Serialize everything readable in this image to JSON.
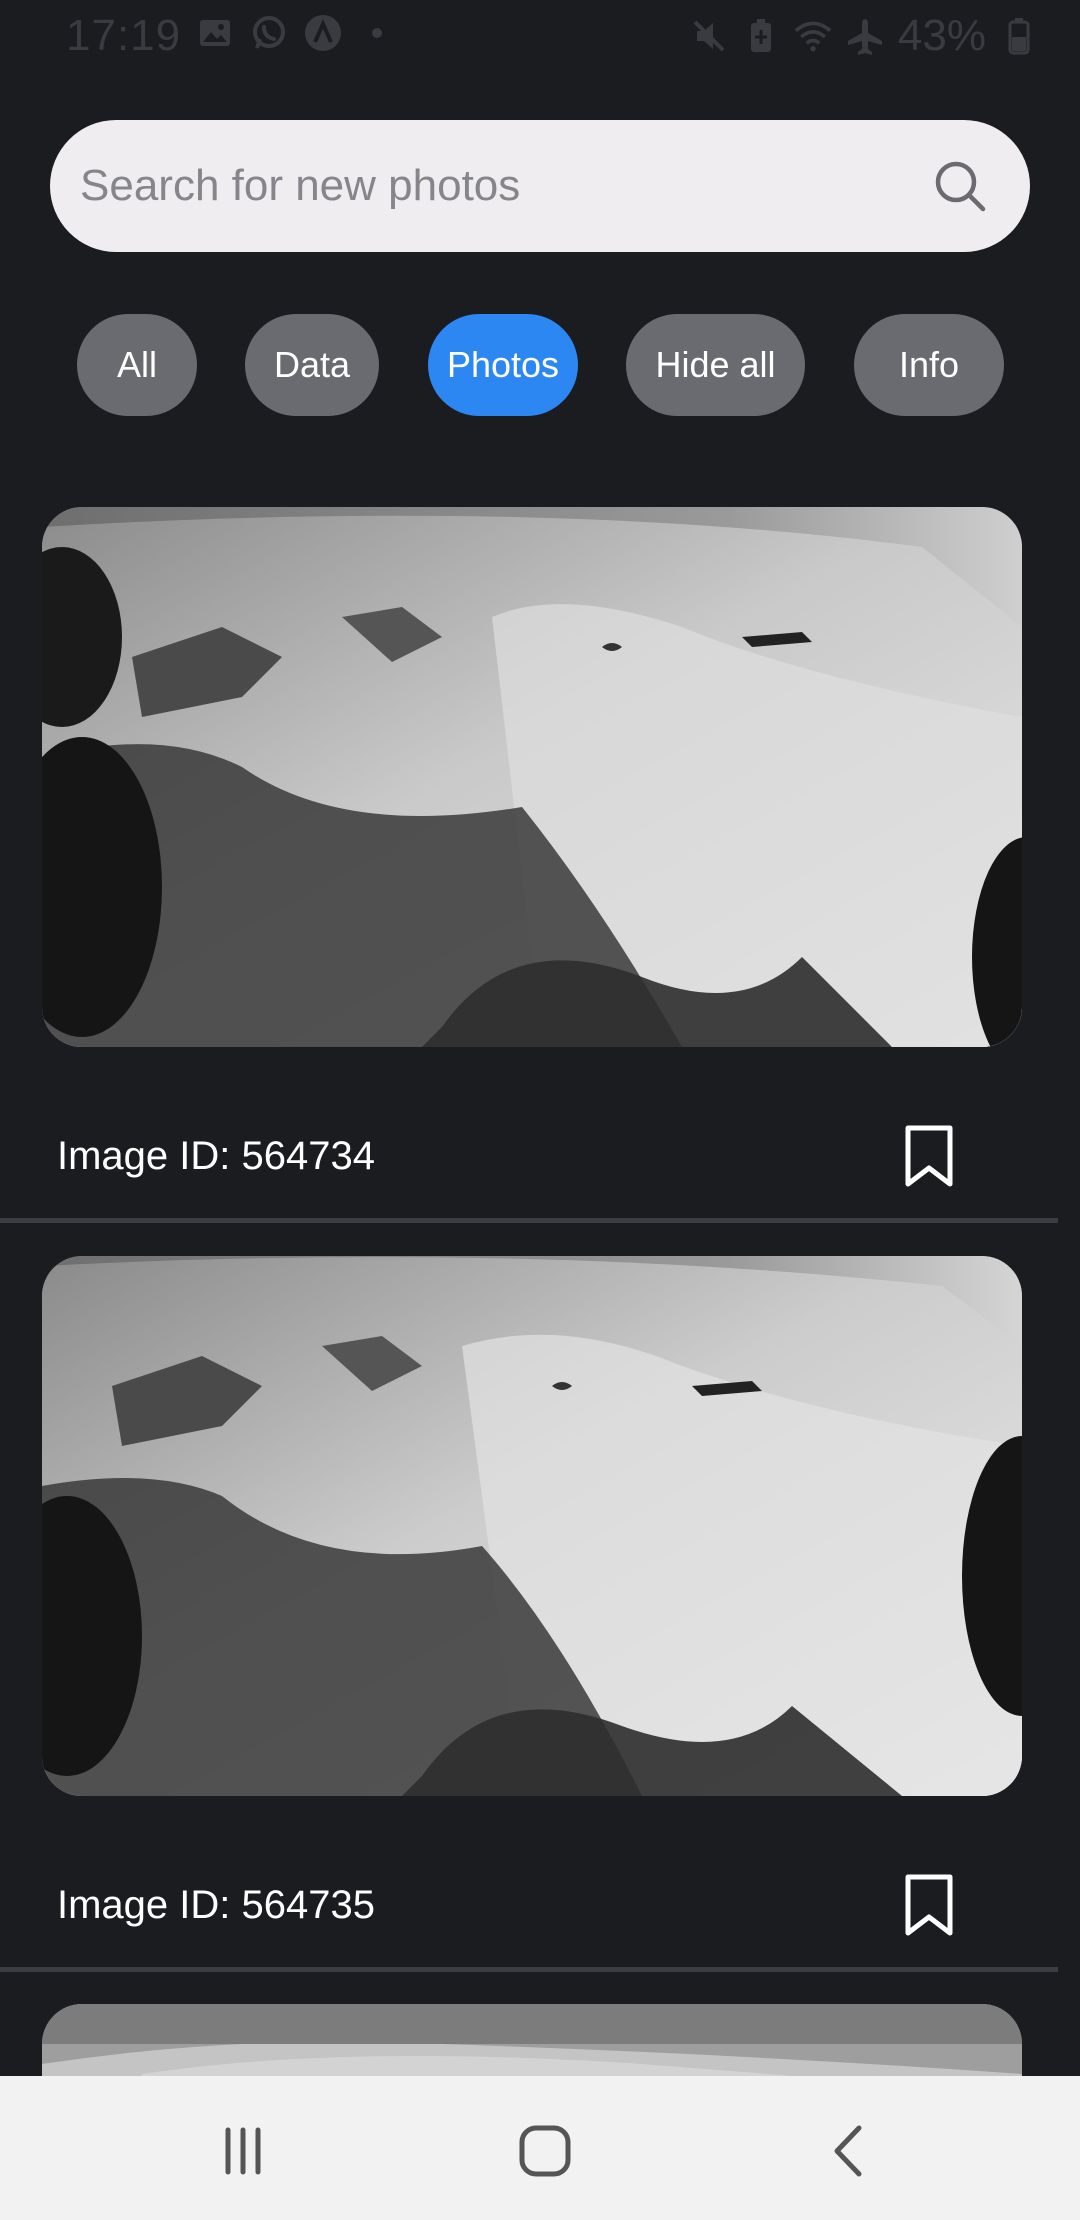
{
  "status_bar": {
    "time": "17:19",
    "battery": "43%",
    "left_icons": [
      "gallery-icon",
      "whatsapp-icon",
      "app-icon",
      "dot-icon"
    ],
    "right_icons": [
      "mute-icon",
      "battery-saver-icon",
      "wifi-icon",
      "airplane-icon",
      "battery-icon"
    ]
  },
  "search": {
    "placeholder": "Search for new photos",
    "icon": "search-icon"
  },
  "filters": {
    "selected": "Photos",
    "chips": [
      "All",
      "Data",
      "Photos",
      "Hide all",
      "Info"
    ]
  },
  "feed": {
    "items": [
      {
        "caption": "Image ID: 564734",
        "bookmark_icon": "bookmark-icon"
      },
      {
        "caption": "Image ID: 564735",
        "bookmark_icon": "bookmark-icon"
      }
    ]
  },
  "nav": {
    "icons": [
      "recent-apps-icon",
      "home-icon",
      "back-icon"
    ]
  },
  "colors": {
    "background": "#1b1c20",
    "chip_active": "#2d87f3",
    "chip_inactive": "#6a6b70",
    "search_bg": "#efedef",
    "nav_bg": "#f2f2f2"
  }
}
